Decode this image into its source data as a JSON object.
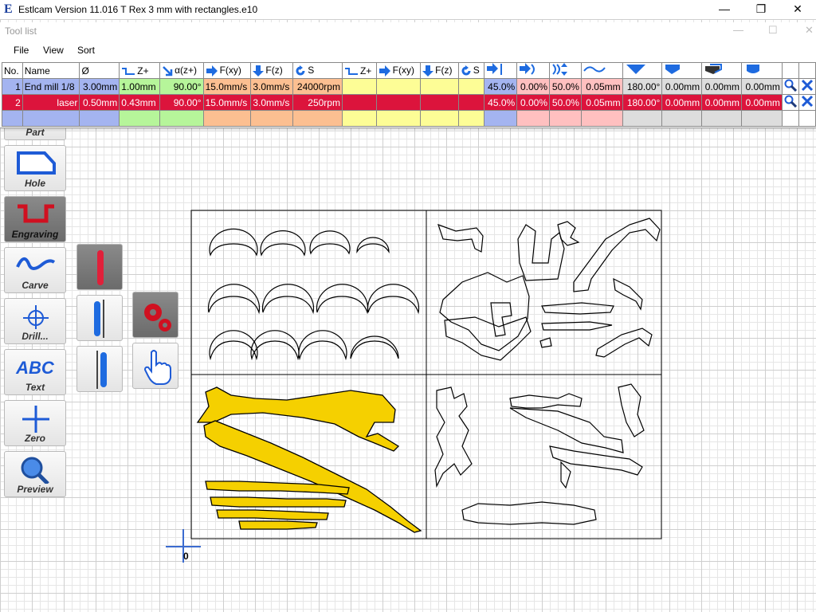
{
  "window": {
    "title": "Estlcam Version 11.016 T Rex 3 mm with rectangles.e10",
    "icon": "estlcam-e-icon"
  },
  "tool_list": {
    "title": "Tool list",
    "menu": [
      "File",
      "View",
      "Sort"
    ],
    "headers": {
      "no": "No.",
      "name": "Name",
      "diameter": "Ø",
      "zplus": "Z+",
      "alpha": "α(z+)",
      "fxy": "F(xy)",
      "fz": "F(z)",
      "s": "S",
      "zplus2": "Z+",
      "fxy2": "F(xy)",
      "fz2": "F(z)",
      "s2": "S"
    },
    "rows": [
      {
        "no": "1",
        "name": "End mill 1/8",
        "diameter": "3.00mm",
        "zplus": "1.00mm",
        "alpha": "90.00°",
        "fxy": "15.0mm/s",
        "fz": "3.0mm/s",
        "s": "24000rpm",
        "p1": "45.0%",
        "p2": "0.00%",
        "p3": "50.0%",
        "p4": "0.05mm",
        "p5": "180.00°",
        "p6": "0.00mm",
        "p7": "0.00mm",
        "p8": "0.00mm"
      },
      {
        "no": "2",
        "name": "laser",
        "diameter": "0.50mm",
        "zplus": "0.43mm",
        "alpha": "90.00°",
        "fxy": "15.0mm/s",
        "fz": "3.0mm/s",
        "s": "250rpm",
        "p1": "45.0%",
        "p2": "0.00%",
        "p3": "50.0%",
        "p4": "0.05mm",
        "p5": "180.00°",
        "p6": "0.00mm",
        "p7": "0.00mm",
        "p8": "0.00mm"
      }
    ]
  },
  "toolbar": {
    "part": "Part",
    "hole": "Hole",
    "engraving": "Engraving",
    "carve": "Carve",
    "drill": "Drill...",
    "text": "Text",
    "text_icon": "ABC",
    "zero": "Zero",
    "preview": "Preview"
  },
  "origin_label": "0",
  "colors": {
    "selected_row": "#a4b4f0",
    "laser_row": "#dc143c",
    "engraving_fill": "#f5d000",
    "grid": "#cfcfcf"
  }
}
